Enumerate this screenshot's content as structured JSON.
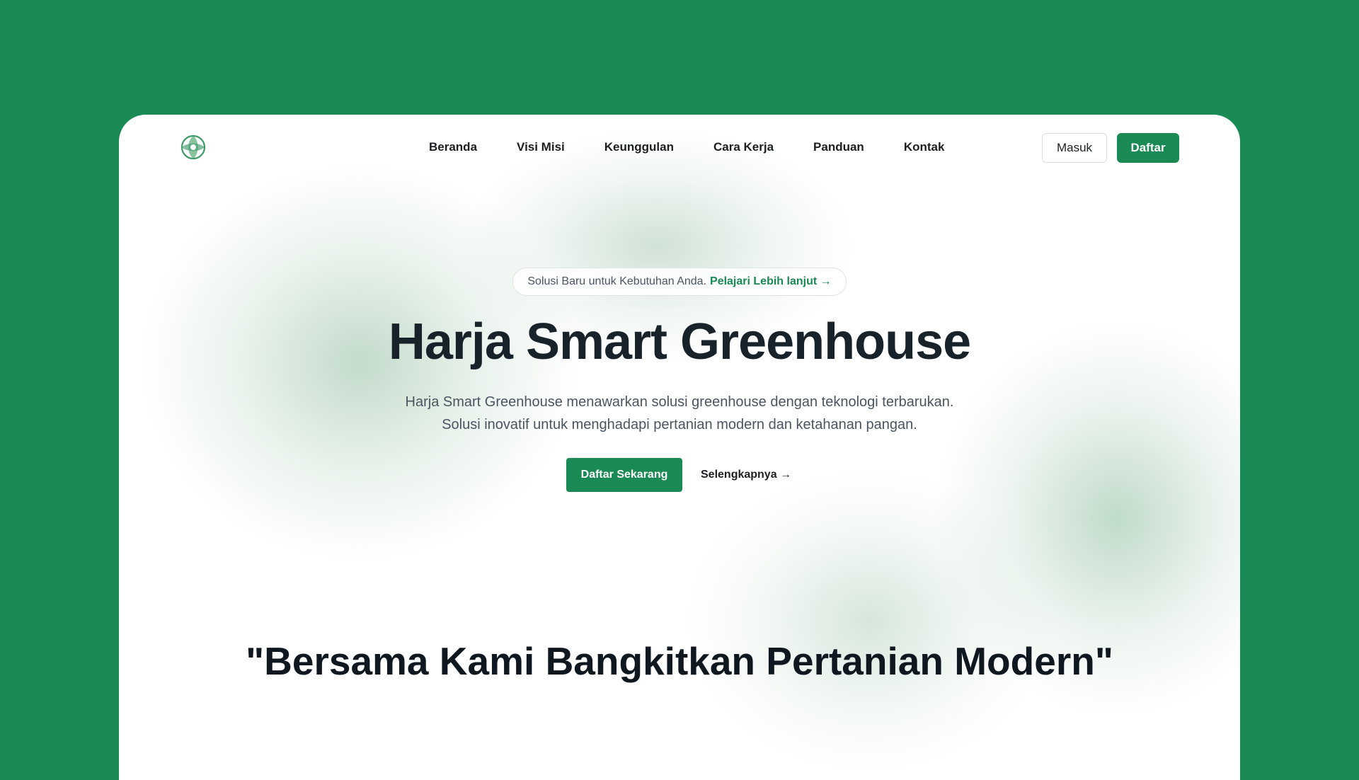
{
  "nav": {
    "links": [
      {
        "label": "Beranda"
      },
      {
        "label": "Visi Misi"
      },
      {
        "label": "Keunggulan"
      },
      {
        "label": "Cara Kerja"
      },
      {
        "label": "Panduan"
      },
      {
        "label": "Kontak"
      }
    ],
    "login_label": "Masuk",
    "register_label": "Daftar",
    "logo_icon": "globe-leaf-icon"
  },
  "hero": {
    "announcement_text": "Solusi Baru untuk Kebutuhan Anda.",
    "announcement_link": "Pelajari Lebih lanjut →",
    "title": "Harja Smart Greenhouse",
    "subtitle_line1": "Harja Smart Greenhouse menawarkan solusi greenhouse dengan teknologi terbarukan.",
    "subtitle_line2": "Solusi inovatif untuk menghadapi pertanian modern dan ketahanan pangan.",
    "primary_cta": "Daftar Sekarang",
    "secondary_cta": "Selengkapnya →"
  },
  "quote": {
    "text": "\"Bersama Kami Bangkitkan Pertanian Modern\""
  },
  "colors": {
    "brand": "#1a8a54",
    "heading": "#17222b",
    "body_text": "#4a5561"
  }
}
